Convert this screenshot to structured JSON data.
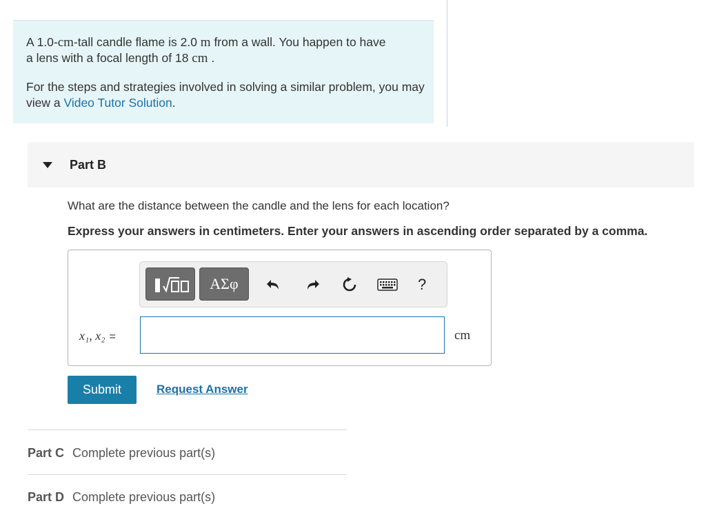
{
  "intro": {
    "line1_a": "A 1.0-",
    "line1_unit_cm": "cm",
    "line1_b": "-tall candle flame is 2.0 ",
    "line1_unit_m": "m",
    "line1_c": " from a wall. You happen to have",
    "line2_a": "a lens with a focal length of 18 ",
    "line2_unit": "cm",
    "line2_b": " .",
    "strategy_text": "For the steps and strategies involved in solving a similar problem, you may view a ",
    "video_link": "Video Tutor Solution",
    "strategy_end": "."
  },
  "part_b": {
    "title": "Part B",
    "question": "What are the distance between the candle and the lens for each location?",
    "instruction": "Express your answers in centimeters. Enter your answers in ascending order separated by a comma.",
    "toolbar": {
      "greek_label": "ΑΣφ",
      "help_label": "?",
      "icons": [
        "templates-icon",
        "undo-icon",
        "redo-icon",
        "reset-icon",
        "keyboard-icon",
        "help-icon"
      ]
    },
    "variable_label": "x₁, x₂",
    "equals": "=",
    "answer_value": "",
    "unit": "cm",
    "submit_label": "Submit",
    "request_label": "Request Answer"
  },
  "part_c": {
    "label": "Part C",
    "status": "Complete previous part(s)"
  },
  "part_d": {
    "label": "Part D",
    "status": "Complete previous part(s)"
  },
  "colors": {
    "accent": "#1a7fa8",
    "intro_bg": "#e6f5f7",
    "link": "#1a72a8"
  }
}
